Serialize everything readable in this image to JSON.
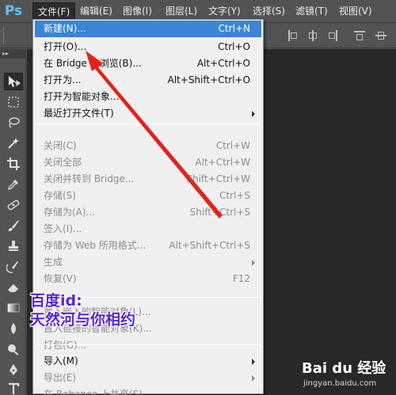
{
  "app": {
    "logo": "Ps"
  },
  "menubar": [
    {
      "label": "文件(F)",
      "active": true
    },
    {
      "label": "编辑(E)"
    },
    {
      "label": "图像(I)"
    },
    {
      "label": "图层(L)"
    },
    {
      "label": "文字(Y)"
    },
    {
      "label": "选择(S)"
    },
    {
      "label": "滤镜(T)"
    },
    {
      "label": "视图(V)"
    }
  ],
  "tools_panel": {
    "collapse_label": "▸▸"
  },
  "file_menu": {
    "items": [
      {
        "label": "新建(N)...",
        "shortcut": "Ctrl+N",
        "highlighted": true
      },
      {
        "label": "打开(O)...",
        "shortcut": "Ctrl+O"
      },
      {
        "label": "在 Bridge 中浏览(B)...",
        "shortcut": "Alt+Ctrl+O"
      },
      {
        "label": "打开为...",
        "shortcut": "Alt+Shift+Ctrl+O"
      },
      {
        "label": "打开为智能对象..."
      },
      {
        "label": "最近打开文件(T)",
        "submenu": true
      },
      {
        "label": "关闭(C)",
        "shortcut": "Ctrl+W",
        "disabled": true
      },
      {
        "label": "关闭全部",
        "shortcut": "Alt+Ctrl+W",
        "disabled": true
      },
      {
        "label": "关闭并转到 Bridge...",
        "shortcut": "Shift+Ctrl+W",
        "disabled": true
      },
      {
        "label": "存储(S)",
        "shortcut": "Ctrl+S",
        "disabled": true
      },
      {
        "label": "存储为(A)...",
        "shortcut": "Shift+Ctrl+S",
        "disabled": true
      },
      {
        "label": "签入(I)...",
        "disabled": true
      },
      {
        "label": "存储为 Web 所用格式...",
        "shortcut": "Alt+Shift+Ctrl+S",
        "disabled": true
      },
      {
        "label": "生成",
        "submenu": true,
        "disabled": true
      },
      {
        "label": "恢复(V)",
        "shortcut": "F12",
        "disabled": true
      },
      {
        "label": "置入嵌入的智能对象(L)...",
        "disabled": true
      },
      {
        "label": "置入链接的智能对象(K)...",
        "disabled": true
      },
      {
        "label": "打包(G)...",
        "disabled": true
      },
      {
        "label": "导入(M)",
        "submenu": true
      },
      {
        "label": "导出(E)",
        "submenu": true,
        "disabled": true
      },
      {
        "label": "在 Behance 上共享(S)...",
        "disabled": true
      }
    ]
  },
  "overlay": {
    "watermark_line1": "百度id:",
    "watermark_line2": "天然河与你相约",
    "brand": "Bai du 经验",
    "brand_url": "jingyan.baidu.com"
  },
  "colors": {
    "highlight": "#3b84d6",
    "arrow": "#e0241b",
    "watermark": "#5627d6",
    "ps_blue": "#5dc3f5"
  }
}
